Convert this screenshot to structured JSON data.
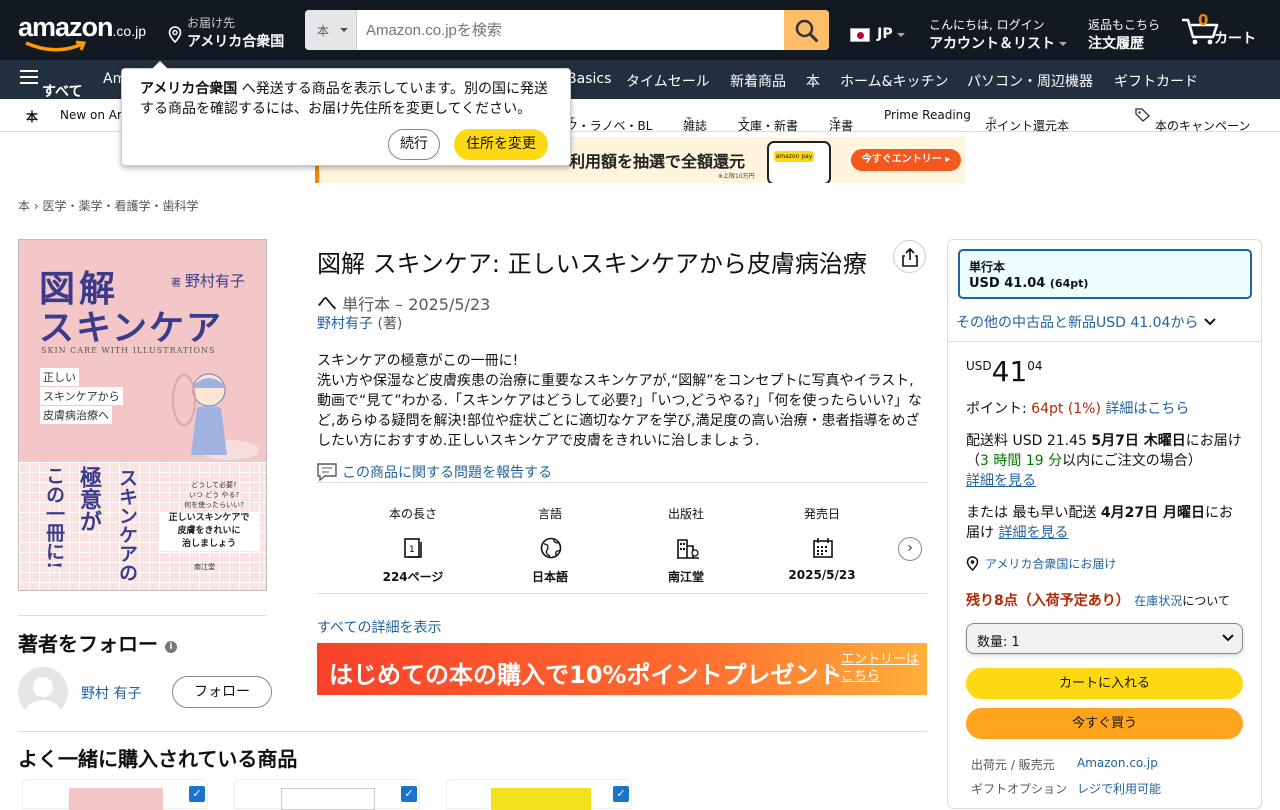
{
  "header": {
    "logo_main": "amazon",
    "logo_suffix": ".co.jp",
    "deliver_line1": "お届け先",
    "deliver_line2": "アメリカ合衆国",
    "search_category": "本",
    "search_placeholder": "Amazon.co.jpを検索",
    "lang": "JP",
    "account_line1": "こんにちは, ログイン",
    "account_line2": "アカウント＆リスト",
    "orders_line1": "返品もこちら",
    "orders_line2": "注文履歴",
    "cart_count": "0",
    "cart_label": "カート"
  },
  "nav": {
    "all": "すべて",
    "items": [
      "Am",
      "Basics",
      "タイムセール",
      "新着商品",
      "本",
      "ホーム&キッチン",
      "パソコン・周辺機器",
      "ギフトカード"
    ]
  },
  "subnav": {
    "section": "本",
    "items": [
      "New on Am",
      "ク・ラノベ・BL",
      "雑誌",
      "文庫・新書",
      "洋書",
      "Prime Reading",
      "ポイント還元本",
      "本のキャンペーン"
    ]
  },
  "popover": {
    "country": "アメリカ合衆国",
    "text": " へ発送する商品を表示しています。別の国に発送する商品を確認するには、お届け先住所を変更してください。",
    "continue": "続行",
    "change": "住所を変更"
  },
  "banner": {
    "text": "利用額を抽選で全額還元",
    "pay": "amazon pay",
    "note": "※上限10万円",
    "cta": "今すぐエントリー ▸"
  },
  "breadcrumb": [
    "本",
    "医学・薬学・看護学・歯科学"
  ],
  "cover": {
    "title1": "図解",
    "title2": "スキンケア",
    "author": "野村有子",
    "author_prefix": "著",
    "english": "SKIN CARE WITH ILLUSTRATIONS",
    "tag1": "正しい",
    "tag2": "スキンケアから",
    "tag3": "皮膚病治療へ",
    "vert1": "スキンケアの",
    "vert2": "極意が",
    "vert3": "この一冊に!",
    "q1": "どうして必要?",
    "q2": "いつ どう やる?",
    "q3": "何を使ったらいい?",
    "h1": "正しいスキンケアで",
    "h2": "皮膚をきれいに",
    "h3": "治しましょう",
    "publisher": "南江堂"
  },
  "product": {
    "title": "図解 スキンケア: 正しいスキンケアから皮膚病治療",
    "title_cont": "へ",
    "format": "単行本 – 2025/5/23",
    "author": "野村有子",
    "author_role": "(著)",
    "description": "スキンケアの極意がこの一冊に!\n洗い方や保湿など皮膚疾患の治療に重要なスキンケアが,“図解”をコンセプトに写真やイラスト,動画で“見て”わかる.「スキンケアはどうして必要?」「いつ,どうやる?」「何を使ったらいい?」など,あらゆる疑問を解決!部位や症状ごとに適切なケアを学び,満足度の高い治療・患者指導をめざしたい方におすすめ.正しいスキンケアで皮膚をきれいに治しましょう.",
    "report": "この商品に関する問題を報告する",
    "attributes": [
      {
        "label": "本の長さ",
        "value": "224ページ",
        "icon": "pages-icon"
      },
      {
        "label": "言語",
        "value": "日本語",
        "icon": "globe-icon"
      },
      {
        "label": "出版社",
        "value": "南江堂",
        "icon": "building-icon"
      },
      {
        "label": "発売日",
        "value": "2025/5/23",
        "icon": "calendar-icon"
      }
    ],
    "all_details": "すべての詳細を表示",
    "promo_text": "はじめての本の購入で10%ポイントプレゼント",
    "promo_entry1": "エントリーは",
    "promo_entry2": "こちら"
  },
  "follow": {
    "title": "著者をフォロー",
    "author": "野村 有子",
    "button": "フォロー"
  },
  "fbt": {
    "title": "よく一緒に購入されている商品"
  },
  "buybox": {
    "format_name": "単行本",
    "format_price": "USD 41.04",
    "format_points": "(64pt)",
    "used_text": "その他の中古品と新品USD 41.04から",
    "currency": "USD",
    "price_whole": "41",
    "price_frac": "04",
    "points_label": "ポイント: ",
    "points_value": "64pt  (1%)",
    "points_link": "詳細はこちら",
    "shipping_pre": "配送料 USD 21.45 ",
    "shipping_date": "5月7日 木曜日",
    "shipping_post": "にお届け",
    "shipping_time_pre": "（",
    "shipping_time": "3 時間 19 分",
    "shipping_time_post": "以内にご注文の場合）",
    "details_link": "詳細を見る",
    "fastest_pre": "または 最も早い配送 ",
    "fastest_date": "4月27日 月曜日",
    "fastest_post": "にお届け ",
    "fastest_link": "詳細を見る",
    "location": "アメリカ合衆国にお届け",
    "stock": "残り8点（入荷予定あり）",
    "stock_link": "在庫状況",
    "stock_post": "について",
    "qty": "数量: 1",
    "add_to_cart": "カートに入れる",
    "buy_now": "今すぐ買う",
    "shipper_label": "出荷元 / 販売元",
    "shipper_value": "Amazon.co.jp",
    "gift_label": "ギフトオプション",
    "gift_value": "レジで利用可能"
  },
  "colors": {
    "header_bg": "#131921",
    "nav_bg": "#232f3e",
    "accent_orange": "#febd69",
    "button_yellow": "#ffd814",
    "button_orange": "#ffa41c",
    "link": "#2162a1",
    "stock_red": "#b12704",
    "time_green": "#007600"
  }
}
